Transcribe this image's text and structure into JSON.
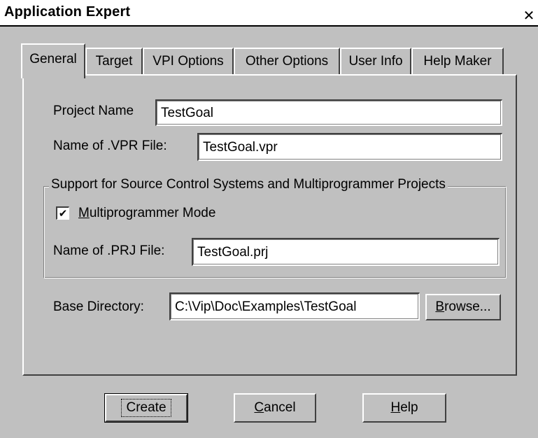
{
  "window": {
    "title": "Application Expert",
    "close_glyph": "✕"
  },
  "tabs": [
    {
      "label": "General",
      "active": true
    },
    {
      "label": "Target",
      "active": false
    },
    {
      "label": "VPI Options",
      "active": false
    },
    {
      "label": "Other Options",
      "active": false
    },
    {
      "label": "User Info",
      "active": false
    },
    {
      "label": "Help Maker",
      "active": false
    }
  ],
  "general": {
    "project_name_label": "Project Name",
    "project_name_value": "TestGoal",
    "vpr_file_label": "Name of .VPR File:",
    "vpr_file_value": "TestGoal.vpr",
    "source_control": {
      "legend": "Support for Source Control Systems and Multiprogrammer Projects",
      "multiprogrammer": {
        "accel": "M",
        "rest": "ultiprogrammer Mode",
        "checked": true,
        "check_glyph": "✔"
      },
      "prj_file_label": "Name of .PRJ File:",
      "prj_file_value": "TestGoal.prj"
    },
    "base_dir_label": "Base Directory:",
    "base_dir_value": "C:\\Vip\\Doc\\Examples\\TestGoal",
    "browse": {
      "accel": "B",
      "rest": "rowse..."
    }
  },
  "buttons": {
    "create": "Create",
    "cancel": {
      "accel": "C",
      "rest": "ancel"
    },
    "help": {
      "accel": "H",
      "rest": "elp"
    }
  },
  "colors": {
    "face": "#c0c0c0",
    "highlight": "#ffffff",
    "shadow": "#404040"
  }
}
